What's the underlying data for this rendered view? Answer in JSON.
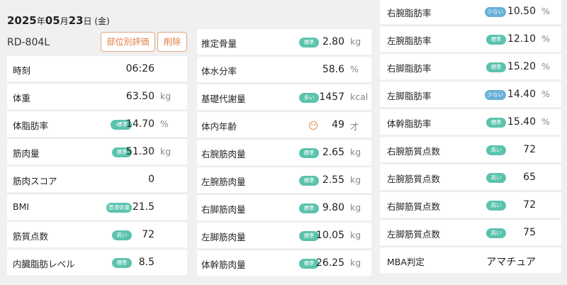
{
  "header": {
    "date_year": "2025",
    "date_year_unit": "年",
    "date_month": "05",
    "date_month_unit": "月",
    "date_day": "23",
    "date_day_unit": "日",
    "date_weekday": " (金)",
    "device": "RD-804L",
    "part_eval_label": "部位別評価",
    "delete_label": "削除"
  },
  "col1": [
    {
      "label": "時刻",
      "value": "06:26",
      "unit": "",
      "badge": ""
    },
    {
      "label": "体重",
      "value": "63.50",
      "unit": "kg",
      "badge": ""
    },
    {
      "label": "体脂肪率",
      "value": "14.70",
      "unit": "%",
      "badge": "-標準"
    },
    {
      "label": "筋肉量",
      "value": "51.30",
      "unit": "kg",
      "badge": "標準"
    },
    {
      "label": "筋肉スコア",
      "value": "0",
      "unit": "",
      "badge": ""
    },
    {
      "label": "BMI",
      "value": "21.5",
      "unit": "",
      "badge": "普通体重"
    },
    {
      "label": "筋質点数",
      "value": "72",
      "unit": "",
      "badge": "高い"
    },
    {
      "label": "内臓脂肪レベル",
      "value": "8.5",
      "unit": "",
      "badge": "標準"
    }
  ],
  "col2": [
    {
      "label": "推定骨量",
      "value": "2.80",
      "unit": "kg",
      "badge": "標準"
    },
    {
      "label": "体水分率",
      "value": "58.6",
      "unit": "%",
      "badge": ""
    },
    {
      "label": "基礎代謝量",
      "value": "1457",
      "unit": "kcal",
      "badge": "多い"
    },
    {
      "label": "体内年齢",
      "value": "49",
      "unit": "才",
      "badge": "",
      "icon": "face-icon"
    },
    {
      "label": "右腕筋肉量",
      "value": "2.65",
      "unit": "kg",
      "badge": "標準"
    },
    {
      "label": "左腕筋肉量",
      "value": "2.55",
      "unit": "kg",
      "badge": "標準"
    },
    {
      "label": "右脚筋肉量",
      "value": "9.80",
      "unit": "kg",
      "badge": "標準"
    },
    {
      "label": "左脚筋肉量",
      "value": "10.05",
      "unit": "kg",
      "badge": "標準"
    },
    {
      "label": "体幹筋肉量",
      "value": "26.25",
      "unit": "kg",
      "badge": "標準"
    }
  ],
  "col3": [
    {
      "label": "右腕脂肪率",
      "value": "10.50",
      "unit": "%",
      "badge": "少ない",
      "badge_color": "blue"
    },
    {
      "label": "左腕脂肪率",
      "value": "12.10",
      "unit": "%",
      "badge": "標準"
    },
    {
      "label": "右脚脂肪率",
      "value": "15.20",
      "unit": "%",
      "badge": "標準"
    },
    {
      "label": "左脚脂肪率",
      "value": "14.40",
      "unit": "%",
      "badge": "少ない",
      "badge_color": "blue"
    },
    {
      "label": "体幹脂肪率",
      "value": "15.40",
      "unit": "%",
      "badge": "標準"
    },
    {
      "label": "右腕筋質点数",
      "value": "72",
      "unit": "",
      "badge": "高い"
    },
    {
      "label": "左腕筋質点数",
      "value": "65",
      "unit": "",
      "badge": "高い"
    },
    {
      "label": "右脚筋質点数",
      "value": "72",
      "unit": "",
      "badge": "高い"
    },
    {
      "label": "左脚筋質点数",
      "value": "75",
      "unit": "",
      "badge": "高い"
    },
    {
      "label": "MBA判定",
      "value": "アマチュア",
      "unit": "",
      "badge": ""
    }
  ],
  "colors": {
    "badge_green": "#5bc3ad",
    "badge_blue": "#67b1d8",
    "accent_orange": "#e07b3e"
  }
}
